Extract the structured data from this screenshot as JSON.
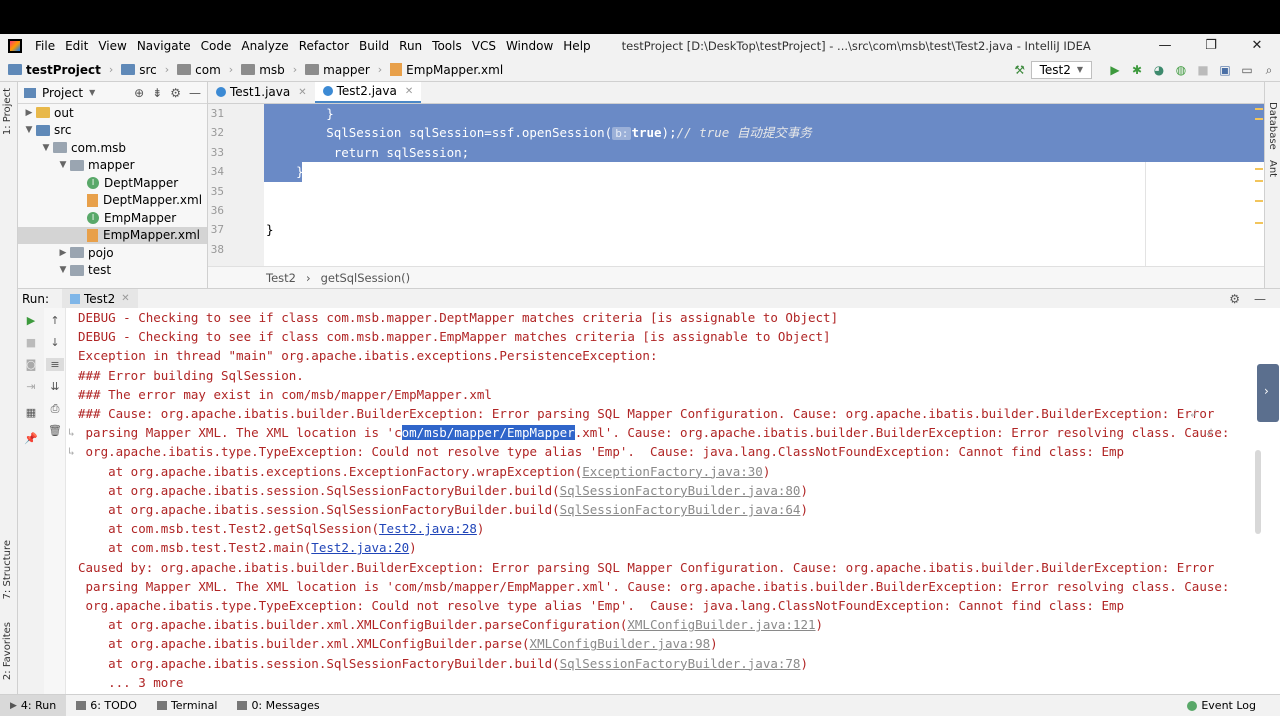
{
  "menu": {
    "items": [
      "File",
      "Edit",
      "View",
      "Navigate",
      "Code",
      "Analyze",
      "Refactor",
      "Build",
      "Run",
      "Tools",
      "VCS",
      "Window",
      "Help"
    ],
    "window_title": "testProject [D:\\DeskTop\\testProject] - ...\\src\\com\\msb\\test\\Test2.java - IntelliJ IDEA",
    "minimize": "—",
    "restore": "❐",
    "close": "✕"
  },
  "nav": {
    "crumbs": [
      "testProject",
      "src",
      "com",
      "msb",
      "mapper",
      "EmpMapper.xml"
    ],
    "run_config": "Test2"
  },
  "project": {
    "title": "Project",
    "tree": [
      {
        "label": "out",
        "arrow": "▶",
        "indent": 0,
        "icon": "orange"
      },
      {
        "label": "src",
        "arrow": "▼",
        "indent": 0,
        "icon": "blue"
      },
      {
        "label": "com.msb",
        "arrow": "▼",
        "indent": 1,
        "icon": "gray"
      },
      {
        "label": "mapper",
        "arrow": "▼",
        "indent": 2,
        "icon": "gray"
      },
      {
        "label": "DeptMapper",
        "arrow": "",
        "indent": 3,
        "icon": "interface"
      },
      {
        "label": "DeptMapper.xml",
        "arrow": "",
        "indent": 3,
        "icon": "xml"
      },
      {
        "label": "EmpMapper",
        "arrow": "",
        "indent": 3,
        "icon": "interface"
      },
      {
        "label": "EmpMapper.xml",
        "arrow": "",
        "indent": 3,
        "icon": "xml",
        "selected": true
      },
      {
        "label": "pojo",
        "arrow": "▶",
        "indent": 2,
        "icon": "gray"
      },
      {
        "label": "test",
        "arrow": "▼",
        "indent": 2,
        "icon": "gray"
      }
    ]
  },
  "editor": {
    "tabs": [
      {
        "label": "Test1.java",
        "active": false
      },
      {
        "label": "Test2.java",
        "active": true
      }
    ],
    "lines": [
      {
        "num": "31",
        "text": "        }",
        "selected": true
      },
      {
        "num": "32",
        "text": "",
        "selected": true
      },
      {
        "num": "33",
        "text": "         return sqlSession;",
        "selected": true
      },
      {
        "num": "34",
        "text": "    }",
        "selected": true
      },
      {
        "num": "35",
        "text": "",
        "selected": false
      },
      {
        "num": "36",
        "text": "",
        "selected": false
      },
      {
        "num": "37",
        "text": "}",
        "selected": false
      },
      {
        "num": "38",
        "text": "",
        "selected": false
      }
    ],
    "line32_prefix": "        SqlSession sqlSession=ssf.openSession(",
    "line32_hint": "b:",
    "line32_kw": "true",
    "line32_mid": ");",
    "line32_comment": "// true 自动提交事务",
    "breadcrumb": [
      "Test2",
      "getSqlSession()"
    ]
  },
  "run": {
    "label": "Run:",
    "tab": "Test2",
    "console": [
      "DEBUG - Checking to see if class com.msb.mapper.DeptMapper matches criteria [is assignable to Object]",
      "DEBUG - Checking to see if class com.msb.mapper.EmpMapper matches criteria [is assignable to Object]",
      "Exception in thread \"main\" org.apache.ibatis.exceptions.PersistenceException: ",
      "### Error building SqlSession.",
      "### The error may exist in com/msb/mapper/EmpMapper.xml",
      "### Cause: org.apache.ibatis.builder.BuilderException: Error parsing SQL Mapper Configuration. Cause: org.apache.ibatis.builder.BuilderException: Error"
    ],
    "wrap1_pre": " parsing Mapper XML. The XML location is 'c",
    "wrap1_hl": "om/msb/mapper/EmpMapper",
    "wrap1_post": ".xml'. Cause: org.apache.ibatis.builder.BuilderException: Error resolving class. Cause:",
    "wrap2": " org.apache.ibatis.type.TypeException: Could not resolve type alias 'Emp'.  Cause: java.lang.ClassNotFoundException: Cannot find class: Emp",
    "trace1": [
      {
        "pre": "    at org.apache.ibatis.exceptions.ExceptionFactory.wrapException(",
        "link": "ExceptionFactory.java:30",
        "post": ")",
        "kind": "gray"
      },
      {
        "pre": "    at org.apache.ibatis.session.SqlSessionFactoryBuilder.build(",
        "link": "SqlSessionFactoryBuilder.java:80",
        "post": ")",
        "kind": "gray"
      },
      {
        "pre": "    at org.apache.ibatis.session.SqlSessionFactoryBuilder.build(",
        "link": "SqlSessionFactoryBuilder.java:64",
        "post": ")",
        "kind": "gray"
      },
      {
        "pre": "    at com.msb.test.Test2.getSqlSession(",
        "link": "Test2.java:28",
        "post": ")",
        "kind": "blue"
      },
      {
        "pre": "    at com.msb.test.Test2.main(",
        "link": "Test2.java:20",
        "post": ")",
        "kind": "blue"
      }
    ],
    "caused": [
      "Caused by: org.apache.ibatis.builder.BuilderException: Error parsing SQL Mapper Configuration. Cause: org.apache.ibatis.builder.BuilderException: Error",
      " parsing Mapper XML. The XML location is 'com/msb/mapper/EmpMapper.xml'. Cause: org.apache.ibatis.builder.BuilderException: Error resolving class. Cause:",
      " org.apache.ibatis.type.TypeException: Could not resolve type alias 'Emp'.  Cause: java.lang.ClassNotFoundException: Cannot find class: Emp"
    ],
    "trace2": [
      {
        "pre": "    at org.apache.ibatis.builder.xml.XMLConfigBuilder.parseConfiguration(",
        "link": "XMLConfigBuilder.java:121",
        "post": ")",
        "kind": "gray"
      },
      {
        "pre": "    at org.apache.ibatis.builder.xml.XMLConfigBuilder.parse(",
        "link": "XMLConfigBuilder.java:98",
        "post": ")",
        "kind": "gray"
      },
      {
        "pre": "    at org.apache.ibatis.session.SqlSessionFactoryBuilder.build(",
        "link": "SqlSessionFactoryBuilder.java:78",
        "post": ")",
        "kind": "gray"
      }
    ],
    "more": "    ... 3 more"
  },
  "sidebars": {
    "left_top": "1: Project",
    "left_mid": "7: Structure",
    "left_bottom": "2: Favorites",
    "right_top": "Database",
    "right_mid": "Ant"
  },
  "status": {
    "buttons": [
      "4: Run",
      "6: TODO",
      "Terminal",
      "0: Messages"
    ],
    "event_log": "Event Log"
  }
}
